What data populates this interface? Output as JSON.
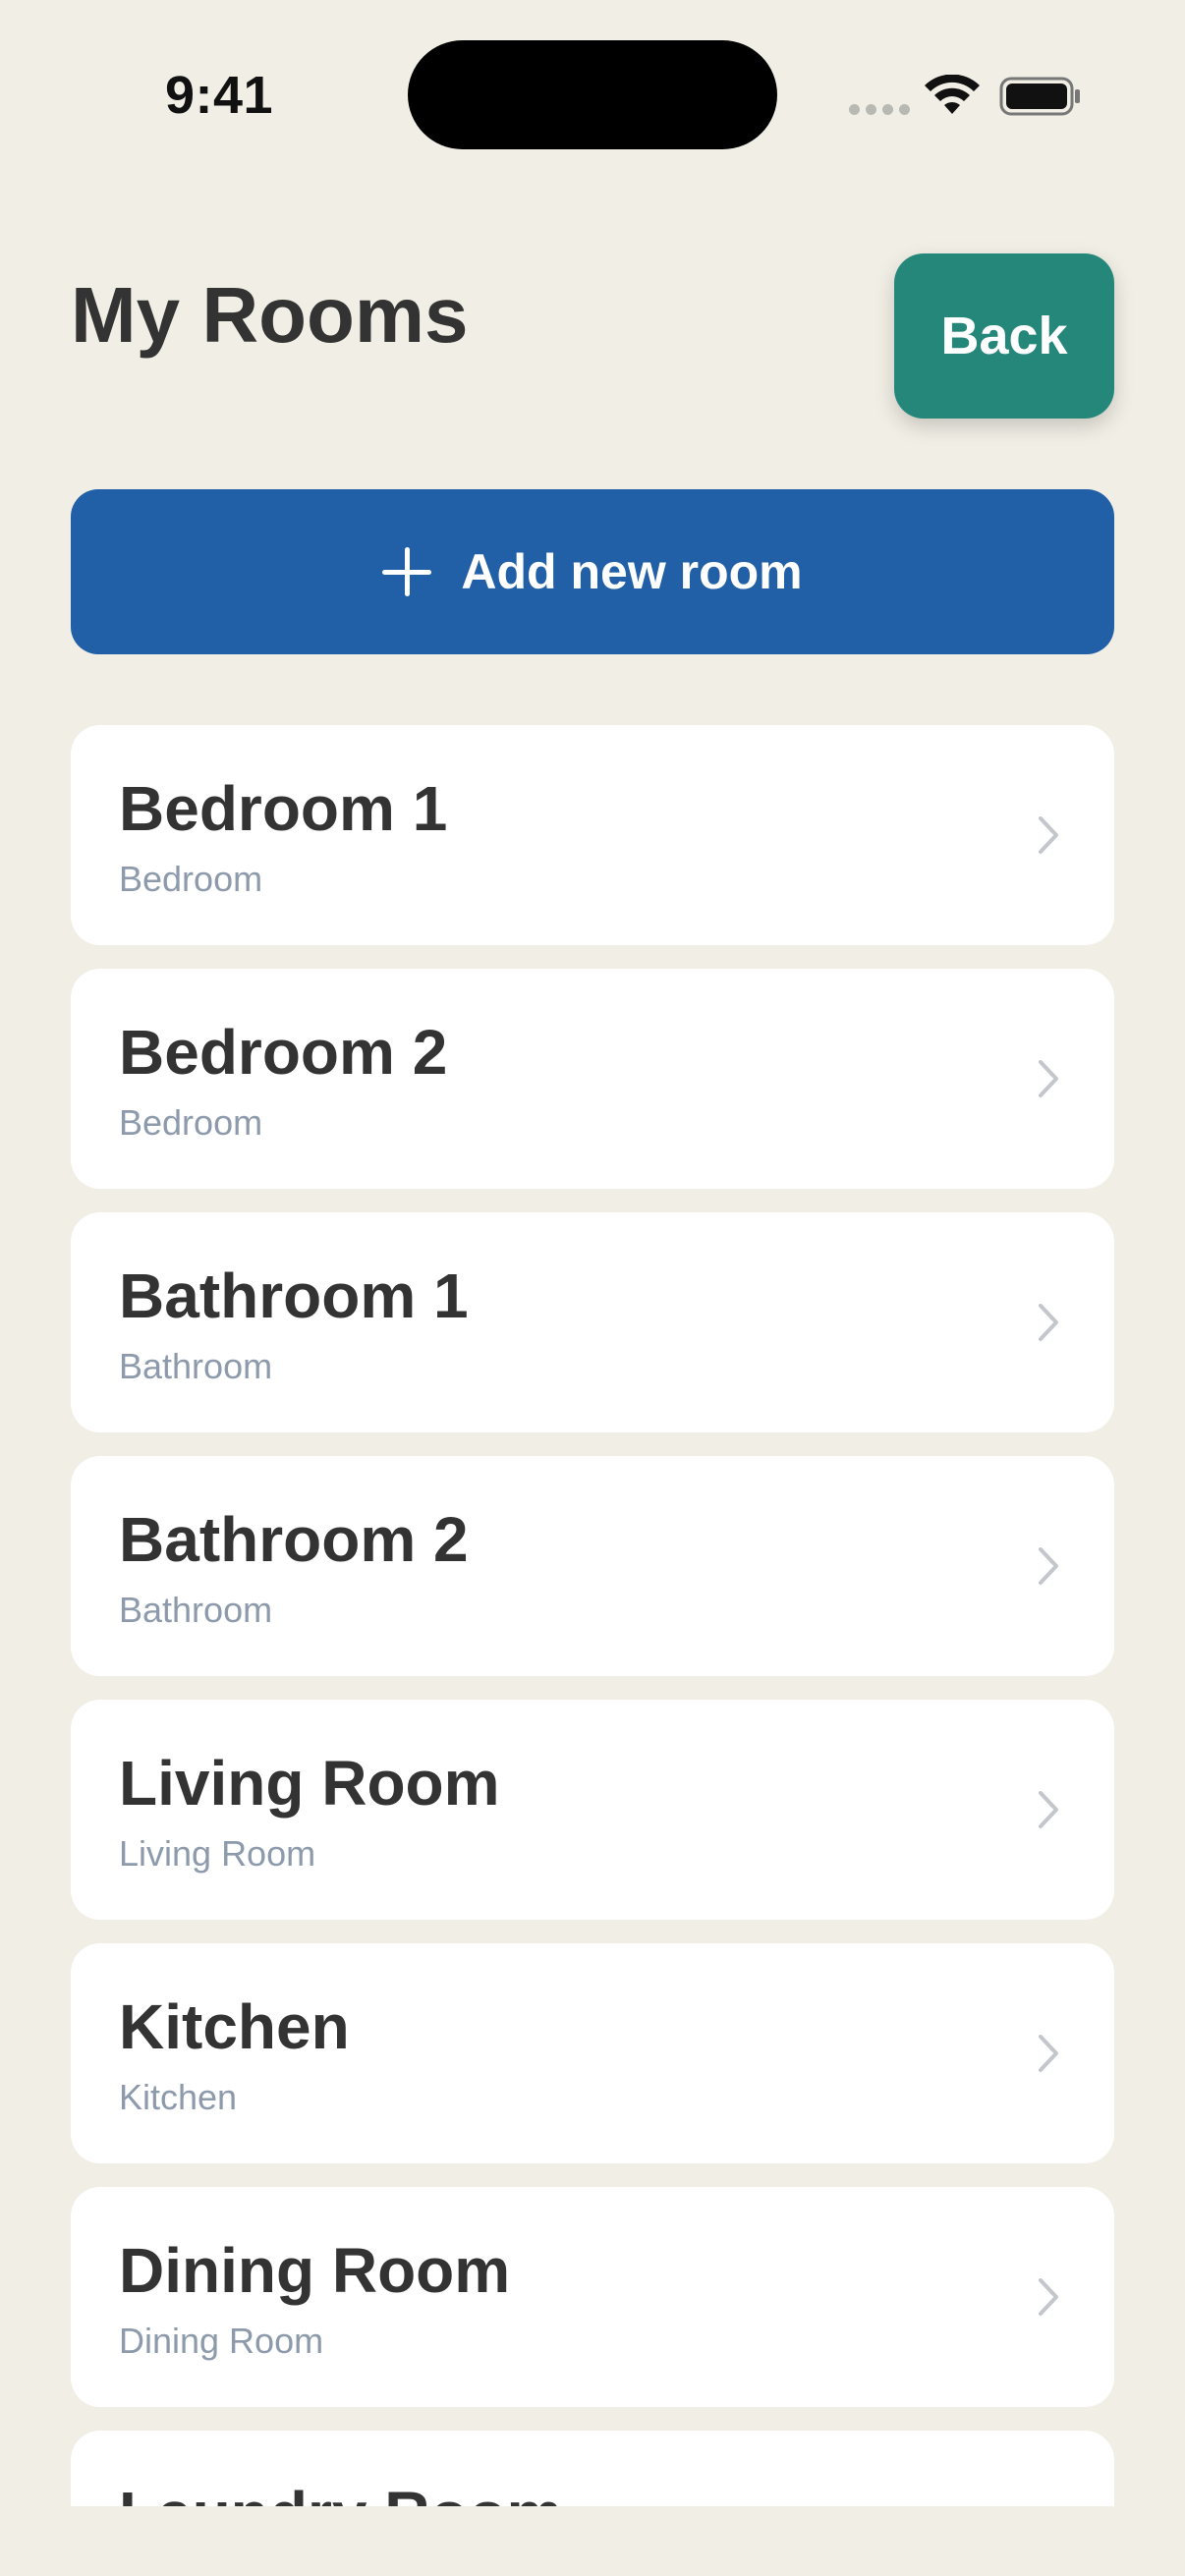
{
  "status_bar": {
    "time": "9:41"
  },
  "header": {
    "title": "My Rooms",
    "back_label": "Back"
  },
  "actions": {
    "add_room_label": "Add new room"
  },
  "rooms": [
    {
      "name": "Bedroom 1",
      "type": "Bedroom"
    },
    {
      "name": "Bedroom 2",
      "type": "Bedroom"
    },
    {
      "name": "Bathroom 1",
      "type": "Bathroom"
    },
    {
      "name": "Bathroom 2",
      "type": "Bathroom"
    },
    {
      "name": "Living Room",
      "type": "Living Room"
    },
    {
      "name": "Kitchen",
      "type": "Kitchen"
    },
    {
      "name": "Dining Room",
      "type": "Dining Room"
    },
    {
      "name": "Laundry Room",
      "type": ""
    }
  ],
  "colors": {
    "background": "#f1efe5",
    "back_button": "#24877a",
    "add_button": "#215fa7",
    "card": "#ffffff",
    "subtitle": "#8c9aab"
  },
  "icons": {
    "add": "plus-icon",
    "row_disclosure": "chevron-right-icon",
    "wifi": "wifi-icon",
    "battery": "battery-icon"
  }
}
